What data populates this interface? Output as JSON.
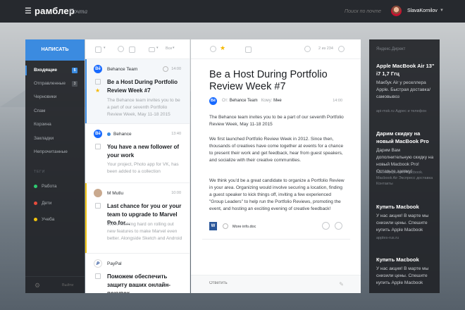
{
  "topbar": {
    "brand": "рамблер",
    "section": "Почта",
    "search_placeholder": "Поиск по почте",
    "user_name": "SlavaKornilov"
  },
  "sidebar": {
    "compose_label": "НАПИСАТЬ",
    "folders": [
      {
        "label": "Входящие",
        "count": "5"
      },
      {
        "label": "Отправленные",
        "count": "3"
      },
      {
        "label": "Черновики",
        "count": ""
      },
      {
        "label": "Спам",
        "count": ""
      },
      {
        "label": "Корзина",
        "count": ""
      },
      {
        "label": "Закладки",
        "count": ""
      },
      {
        "label": "Непрочитанные",
        "count": ""
      }
    ],
    "tags_header": "ТЕГИ",
    "tags": [
      {
        "label": "Работа",
        "color": "#2ecc71"
      },
      {
        "label": "Дети",
        "color": "#e74c3c"
      },
      {
        "label": "Учеба",
        "color": "#f1c40f"
      }
    ],
    "exit_label": "Выйти"
  },
  "list": {
    "toolbar": {
      "sort_label": "Все"
    },
    "messages": [
      {
        "from": "Behance Team",
        "time": "14:00",
        "subject": "Be a Host During Portfolio Review Week #7",
        "preview": "The Behance team invites you to be a part of our seventh Portfolio Review Week, May 11-18 2015",
        "starred": true,
        "unread": false,
        "bar_color": "#3b8be0",
        "avatar_text": "Bē",
        "avatar_color": "#1769ff"
      },
      {
        "from": "Behance",
        "time": "13:40",
        "subject": "You have a new follower of your work",
        "preview": "Your project, Photo app for VK, has been added to a collection",
        "starred": false,
        "unread": true,
        "bar_color": "",
        "avatar_text": "Bē",
        "avatar_color": "#1769ff"
      },
      {
        "from": "M Mutlu",
        "time": "10:00",
        "subject": "Last chance for you or your team to upgrade to Marvel Pro for...",
        "preview": "We're working hard on rolling out new features to make Marvel even better. Alongside Sketch and Android export...",
        "starred": false,
        "unread": false,
        "bar_color": "#f1c40f",
        "avatar_text": "",
        "avatar_color": "#c9a98e"
      },
      {
        "from": "PayPal",
        "time": "",
        "subject": "Поможем обеспечить защиту ваших онлайн-покупок.",
        "preview": "",
        "starred": false,
        "unread": false,
        "bar_color": "",
        "avatar_text": "P",
        "avatar_color": "#ffffff"
      }
    ]
  },
  "reader": {
    "toolbar": {
      "pager": "2 из 234"
    },
    "title": "Be a Host During Portfolio Review Week #7",
    "from_prefix": "От:",
    "from_name": "Behance Team",
    "to_prefix": "Кому:",
    "to_name": "Мне",
    "time": "14:00",
    "paragraphs": [
      "The Behance team invites you to be a part of our seventh Portfolio Review Week, May 11-18 2015",
      "We first launched Portfolio Review Week in 2012. Since then, thousands of creatives have come together at events for a chance to present their work and get feedback, hear from guest speakers, and socialize with their creative communities.",
      "We think you'd be a great candidate to organize a Portfolio Review in your area. Organizing would involve securing a location, finding a guest speaker to kick things off, inviting a few experienced \"Group Leaders\" to help run the Portfolio Reviews, promoting the event, and hosting an exciting evening of creative feedback!"
    ],
    "attachment": {
      "name": "More info.doc",
      "type_icon": "W"
    },
    "reply_placeholder": "Ответить"
  },
  "ads": {
    "header": "Яндекс.Директ",
    "items": [
      {
        "title": "Apple MacBook Air 13\" i7 1,7 Ггц",
        "desc": "Макбук Air у реселлера Apple. Быстрая доставка/самовывоз",
        "meta": "api-msk.ru   Адрес и телефон"
      },
      {
        "title": "Дарим скидку на новый MacBook Pro",
        "desc": "Дарим Вам дополнительную скидку на новый Macbook Pro! Оставьте заявку!",
        "meta": "Аксессуары для Macbook. Macbook Air Экспресс доставка Контакты"
      },
      {
        "title": "Купить Macbook",
        "desc": "У нас акция! В марте мы снизили цены. Спешите купить Apple Macbook",
        "meta": "apples-rus.ru"
      },
      {
        "title": "Купить Macbook",
        "desc": "У нас акция! В марте мы снизили цены. Спешите купить Apple Macbook",
        "meta": ""
      }
    ]
  }
}
